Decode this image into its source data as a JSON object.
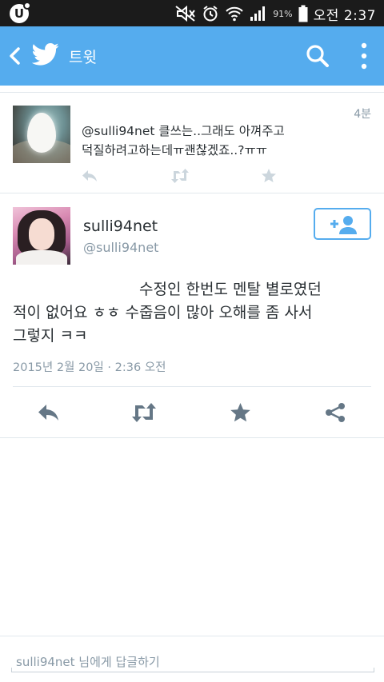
{
  "status_bar": {
    "app_badge": "U",
    "battery_percent": "91%",
    "clock": "오전 2:37"
  },
  "app_bar": {
    "title": "트윗",
    "icons": [
      "back-icon",
      "twitter-bird-icon",
      "search-icon",
      "overflow-menu-icon"
    ],
    "color": "#55acee"
  },
  "parent_tweet": {
    "time": "4분",
    "text_line1": "@sulli94net 클쓰는..그래도 아껴주고",
    "text_line2": "덕질하려고하는데ㅠ괜찮겠죠..?ㅠㅠ",
    "actions": [
      "reply-icon",
      "retweet-icon",
      "favorite-icon"
    ]
  },
  "main_tweet": {
    "name": "sulli94net",
    "handle": "@sulli94net",
    "text_line1": "수정인 한번도 멘탈 별로였던",
    "text_line2": "적이 없어요 ㅎㅎ 수줍음이 많아 오해를 좀 사서",
    "text_line3": "그렇지 ㅋㅋ",
    "date": "2015년 2월 20일 · 2:36 오전",
    "actions": [
      "reply-icon",
      "retweet-icon",
      "favorite-icon",
      "share-icon"
    ]
  },
  "reply": {
    "placeholder": "sulli94net 님에게 답글하기"
  },
  "colors": {
    "accent": "#55acee",
    "icon_gray": "#8899a6",
    "main_icon": "#657786"
  }
}
